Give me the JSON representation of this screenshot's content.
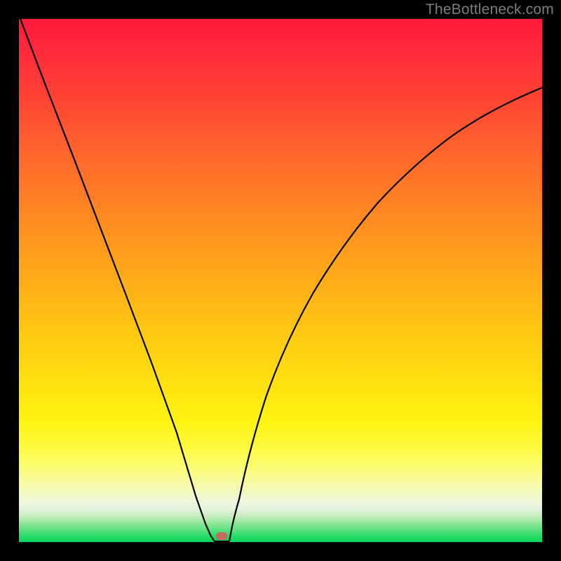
{
  "watermark": "TheBottleneck.com",
  "chart_data": {
    "type": "line",
    "title": "",
    "xlabel": "",
    "ylabel": "",
    "xlim": [
      0,
      100
    ],
    "ylim": [
      0,
      100
    ],
    "series": [
      {
        "name": "bottleneck-curve-left",
        "x": [
          0,
          5,
          10,
          15,
          20,
          25,
          30,
          34,
          36,
          37,
          37.5
        ],
        "values": [
          100,
          86,
          73,
          60,
          47,
          33,
          20,
          8,
          3,
          1,
          0
        ]
      },
      {
        "name": "bottleneck-curve-right",
        "x": [
          37.5,
          39,
          41,
          44,
          48,
          53,
          59,
          66,
          74,
          83,
          92,
          100
        ],
        "values": [
          0,
          2,
          8,
          18,
          30,
          42,
          53,
          63,
          71,
          78,
          83,
          87
        ]
      }
    ],
    "marker": {
      "x": 38.5,
      "y": 0.5
    },
    "background_gradient": {
      "top_color": "#ff1a3c",
      "mid_color": "#ffe210",
      "bottom_color": "#0bd75c"
    }
  }
}
